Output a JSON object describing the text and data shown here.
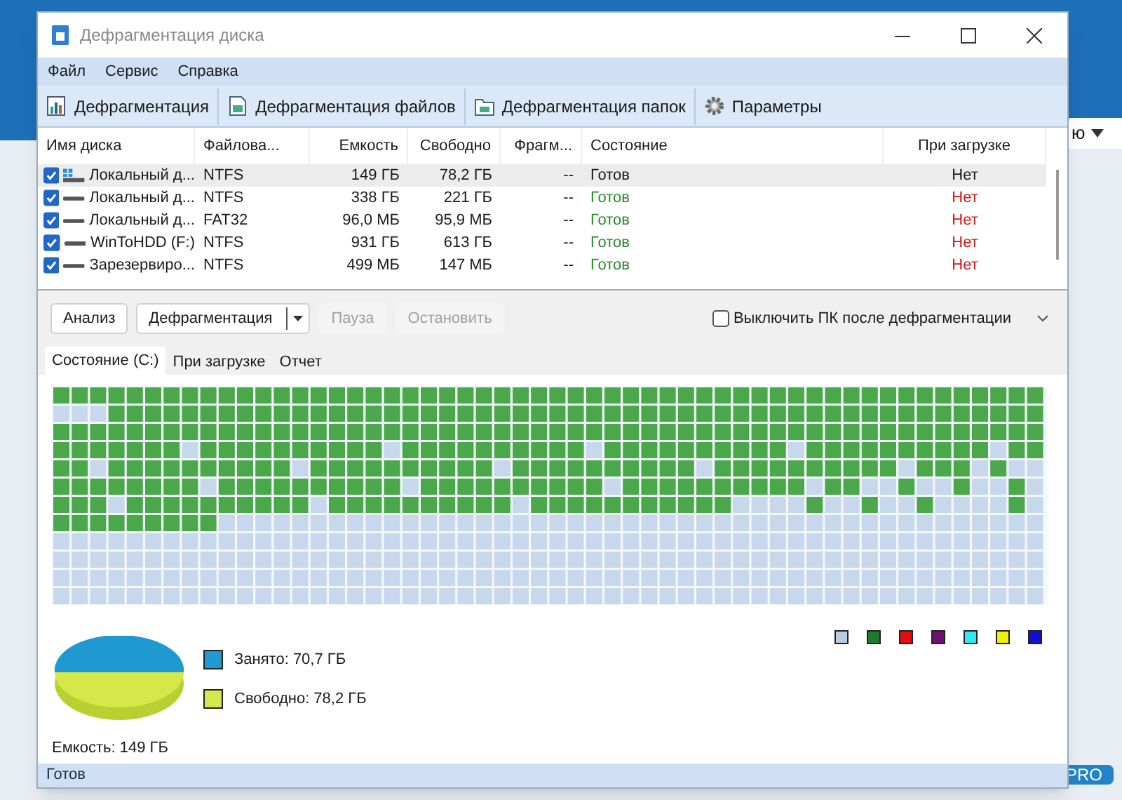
{
  "background": {
    "dropdown": "ю",
    "badge": "PRO"
  },
  "window": {
    "title": "Дефрагментация диска"
  },
  "menu": [
    "Файл",
    "Сервис",
    "Справка"
  ],
  "toolbar": [
    "Дефрагментация",
    "Дефрагментация файлов",
    "Дефрагментация папок",
    "Параметры"
  ],
  "table": {
    "columns": [
      "Имя диска",
      "Файлова...",
      "Емкость",
      "Свободно",
      "Фрагм...",
      "Состояние",
      "При загрузке"
    ],
    "rows": [
      {
        "checked": true,
        "selected": true,
        "kind": "system",
        "cells": [
          "Локальный д...",
          "NTFS",
          "149 ГБ",
          "78,2 ГБ",
          "--",
          "Готов",
          "Нет"
        ]
      },
      {
        "checked": true,
        "selected": false,
        "kind": "drive",
        "cells": [
          "Локальный д...",
          "NTFS",
          "338 ГБ",
          "221 ГБ",
          "--",
          "Готов",
          "Нет"
        ]
      },
      {
        "checked": true,
        "selected": false,
        "kind": "drive",
        "cells": [
          "Локальный д...",
          "FAT32",
          "96,0 МБ",
          "95,9 МБ",
          "--",
          "Готов",
          "Нет"
        ]
      },
      {
        "checked": true,
        "selected": false,
        "kind": "drive",
        "cells": [
          "WinToHDD (F:)",
          "NTFS",
          "931 ГБ",
          "613 ГБ",
          "--",
          "Готов",
          "Нет"
        ]
      },
      {
        "checked": true,
        "selected": false,
        "kind": "drive",
        "cells": [
          "Зарезервиро...",
          "NTFS",
          "499 МБ",
          "147 МБ",
          "--",
          "Готов",
          "Нет"
        ]
      }
    ]
  },
  "actions": [
    {
      "label": "Анализ",
      "disabled": false,
      "kind": "button"
    },
    {
      "label": "Дефрагментация",
      "disabled": false,
      "kind": "split"
    },
    {
      "label": "Пауза",
      "disabled": true,
      "kind": "button"
    },
    {
      "label": "Остановить",
      "disabled": true,
      "kind": "button"
    }
  ],
  "shutdown_option": {
    "label": "Выключить ПК после дефрагментации",
    "checked": false
  },
  "tabs": [
    {
      "label": "Состояние (C:)",
      "selected": true
    },
    {
      "label": "При загрузке",
      "selected": false
    },
    {
      "label": "Отчет",
      "selected": false
    }
  ],
  "legend": [
    {
      "color": "#b8cce4"
    },
    {
      "color": "#1e7a2e"
    },
    {
      "color": "#e01010"
    },
    {
      "color": "#701070"
    },
    {
      "color": "#30e8f0"
    },
    {
      "color": "#f0f010"
    },
    {
      "color": "#1010d0"
    }
  ],
  "usage": [
    {
      "label": "Занято: 70,7 ГБ",
      "color": "#1e9ad0"
    },
    {
      "label": "Свободно: 78,2 ГБ",
      "color": "#d4e84a"
    }
  ],
  "capacity": "Емкость: 149 ГБ",
  "status_bar": "Готов"
}
